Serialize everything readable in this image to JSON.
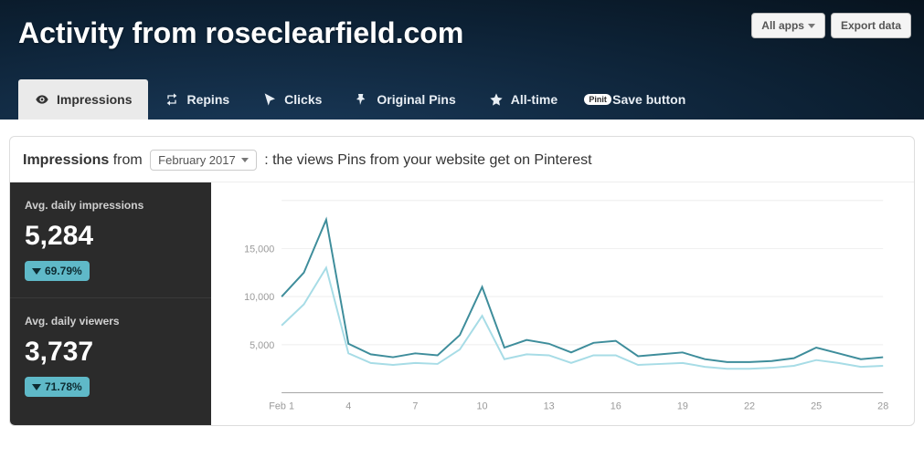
{
  "header": {
    "title": "Activity from roseclearfield.com",
    "all_apps_label": "All apps",
    "export_label": "Export data"
  },
  "tabs": [
    {
      "icon": "eye-icon",
      "label": "Impressions",
      "active": true
    },
    {
      "icon": "repin-icon",
      "label": "Repins",
      "active": false
    },
    {
      "icon": "cursor-icon",
      "label": "Clicks",
      "active": false
    },
    {
      "icon": "pin-icon",
      "label": "Original Pins",
      "active": false
    },
    {
      "icon": "star-icon",
      "label": "All-time",
      "active": false
    },
    {
      "icon": "pinit-badge-icon",
      "label": "Save button",
      "active": false
    }
  ],
  "card": {
    "title_strong": "Impressions",
    "title_from": "from",
    "period": "February 2017",
    "title_rest": ": the views Pins from your website get on Pinterest"
  },
  "stats": [
    {
      "label": "Avg. daily impressions",
      "value": "5,284",
      "delta_dir": "down",
      "delta": "69.79%"
    },
    {
      "label": "Avg. daily viewers",
      "value": "3,737",
      "delta_dir": "down",
      "delta": "71.78%"
    }
  ],
  "chart_data": {
    "type": "line",
    "title": "",
    "xlabel": "",
    "ylabel": "",
    "ylim": [
      0,
      20000
    ],
    "y_ticks": [
      5000,
      10000,
      15000
    ],
    "y_tick_labels": [
      "5,000",
      "10,000",
      "15,000"
    ],
    "x_tick_positions": [
      1,
      4,
      7,
      10,
      13,
      16,
      19,
      22,
      25,
      28
    ],
    "x_tick_labels": [
      "Feb 1",
      "4",
      "7",
      "10",
      "13",
      "16",
      "19",
      "22",
      "25",
      "28"
    ],
    "x": [
      1,
      2,
      3,
      4,
      5,
      6,
      7,
      8,
      9,
      10,
      11,
      12,
      13,
      14,
      15,
      16,
      17,
      18,
      19,
      20,
      21,
      22,
      23,
      24,
      25,
      26,
      27,
      28
    ],
    "series": [
      {
        "name": "Avg. daily impressions",
        "values": [
          10000,
          12500,
          18000,
          5100,
          4000,
          3700,
          4100,
          3900,
          6000,
          11000,
          4700,
          5500,
          5100,
          4200,
          5200,
          5400,
          3800,
          4000,
          4200,
          3500,
          3200,
          3200,
          3300,
          3600,
          4700,
          4100,
          3500,
          3700
        ]
      },
      {
        "name": "Avg. daily viewers",
        "values": [
          7000,
          9200,
          13000,
          4100,
          3100,
          2900,
          3100,
          3000,
          4500,
          8000,
          3500,
          4000,
          3900,
          3100,
          3900,
          3900,
          2900,
          3000,
          3100,
          2700,
          2500,
          2500,
          2600,
          2800,
          3400,
          3100,
          2700,
          2800
        ]
      }
    ]
  }
}
